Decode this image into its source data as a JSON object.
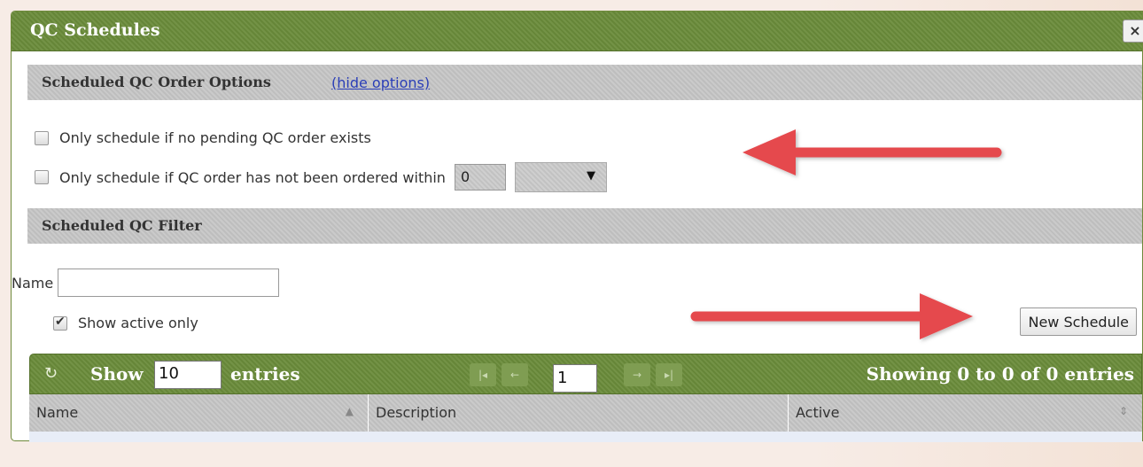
{
  "dialog": {
    "title": "QC Schedules",
    "close_icon": "×"
  },
  "options_section": {
    "title": "Scheduled QC Order Options",
    "toggle_link": "(hide options)",
    "option1_label": "Only schedule if no pending QC order exists",
    "option2_label": "Only schedule if QC order has not been ordered within",
    "within_value": "0",
    "unit_selected": ""
  },
  "filter_section": {
    "title": "Scheduled QC Filter",
    "name_label": "Name",
    "name_value": "",
    "active_only_label": "Show active only",
    "active_only_checked": true
  },
  "actions": {
    "new_schedule_label": "New Schedule"
  },
  "table_toolbar": {
    "refresh_icon": "↻",
    "show_label": "Show",
    "page_length": "10",
    "entries_label": "entries",
    "first_icon": "|◂",
    "prev_icon": "←",
    "page_number": "1",
    "next_icon": "→",
    "last_icon": "▸|",
    "info_text": "Showing 0 to 0 of 0 entries"
  },
  "table": {
    "columns": [
      {
        "label": "Name",
        "sort_icon": "▲"
      },
      {
        "label": "Description",
        "sort_icon": ""
      },
      {
        "label": "Active",
        "sort_icon": "⇕"
      }
    ],
    "rows": []
  },
  "colors": {
    "titlebar": "#6a8b3a",
    "section_bar": "#c4c4c4",
    "link": "#2a3eb8"
  }
}
